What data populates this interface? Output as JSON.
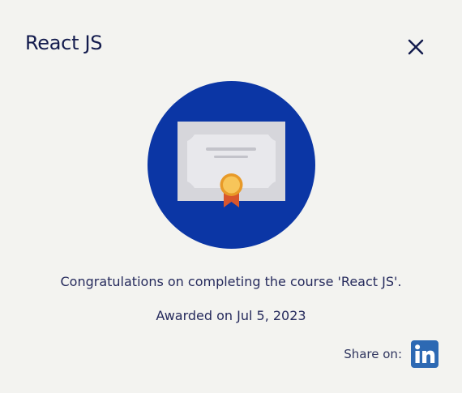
{
  "dialog": {
    "title": "React JS",
    "close_icon": "close-icon",
    "badge_icon": "certificate-icon",
    "message": "Congratulations on completing the course 'React JS'.",
    "awarded": "Awarded on Jul 5, 2023",
    "share_label": "Share on:",
    "share_icon": "linkedin-icon",
    "colors": {
      "background": "#f3f3f0",
      "title": "#131b4d",
      "circle": "#0b36a5",
      "linkedin": "#2d69b3",
      "seal": "#f3b13b",
      "ribbon": "#d9562c"
    }
  }
}
